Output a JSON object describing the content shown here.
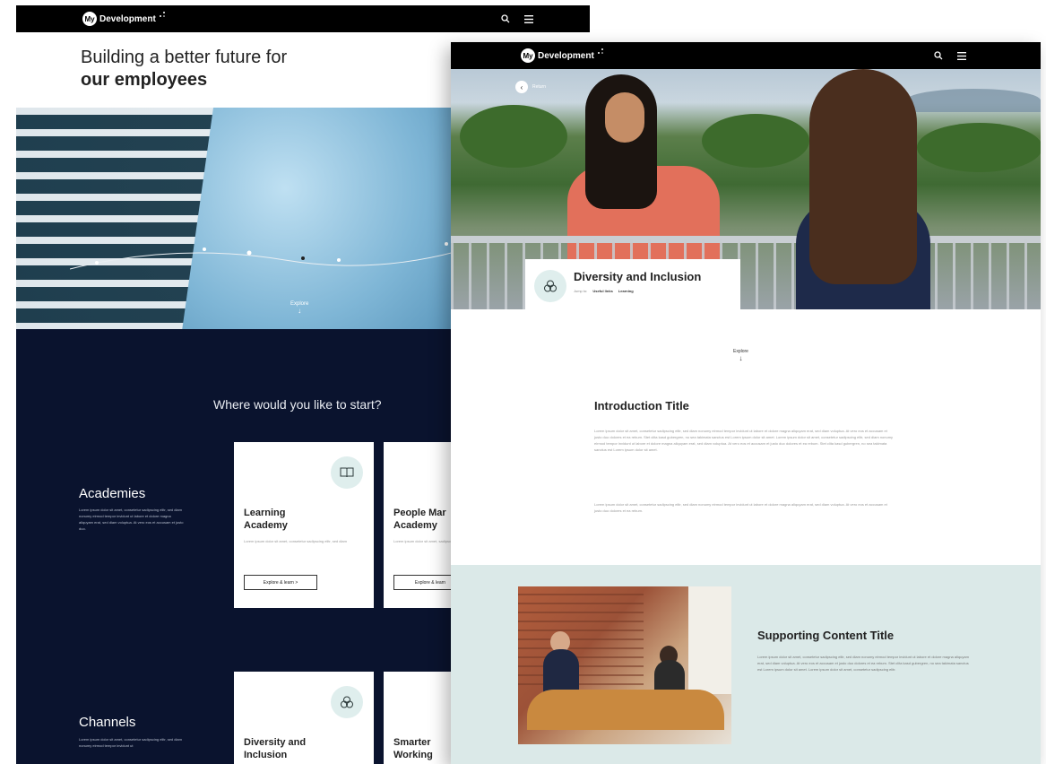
{
  "left_page": {
    "nav": {
      "logo_badge": "My",
      "logo_text": "Development",
      "icons": [
        "search-icon",
        "menu-icon"
      ]
    },
    "hero": {
      "title_line1": "Building a better future for",
      "title_line2": "our employees",
      "explore_label": "Explore"
    },
    "start_heading": "Where would you like to start?",
    "academies": {
      "title": "Academies",
      "text": "Lorem ipsum dolor sit amet, consetetur sadipscing elitr, sed diam nonumy eirmod tempor invidunt ut labore et dolore magna aliquyam erat, sed diam voluptua. At vero eos et accusam et justo duo."
    },
    "channels": {
      "title": "Channels",
      "text": "Lorem ipsum dolor sit amet, consetetur sadipscing elitr, sed diam nonumy eirmod tempor invidunt ut"
    },
    "cards": [
      {
        "title_line1": "Learning",
        "title_line2": "Academy",
        "text": "Lorem ipsum dolor sit amet, consetetur sadipscing elitr, sed diam",
        "button": "Explore & learn  >",
        "icon": "book-icon"
      },
      {
        "title_line1": "People Mar",
        "title_line2": "Academy",
        "text": "Lorem ipsum dolor sit amet, sadipscing elitr, sed diam",
        "button": "Explore & learn",
        "icon": ""
      },
      {
        "title_line1": "Diversity and",
        "title_line2": "Inclusion",
        "text": "",
        "button": "",
        "icon": "inclusion-icon"
      },
      {
        "title_line1": "Smarter",
        "title_line2": "Working",
        "text": "",
        "button": "",
        "icon": ""
      }
    ]
  },
  "right_page": {
    "nav": {
      "logo_badge": "My",
      "logo_text": "Development",
      "icons": [
        "search-icon",
        "menu-icon"
      ]
    },
    "return_label": "Return",
    "di_card": {
      "title": "Diversity and Inclusion",
      "jump_label": "Jump to:",
      "links": [
        "Useful links",
        "Learning"
      ],
      "icon": "inclusion-icon"
    },
    "explore_label": "Explore",
    "intro": {
      "title": "Introduction Title",
      "para1": "Lorem ipsum dolor sit amet, consetetur sadipscing elitr, sed diam nonumy eirmod tempor invidunt ut labore et dolore magna aliquyam erat, sed diam voluptua. At vero eos et accusam et justo duo dolores et ea rebum. Stet clita kasd gubergren, no sea takimata sanctus est Lorem ipsum dolor sit amet. Lorem ipsum dolor sit amet, consetetur sadipscing elitr, sed diam nonumy eirmod tempor invidunt ut labore et dolore magna aliquyam erat, sed diam voluptua. At vero eos et accusam et justo duo dolores et ea rebum. Stet clita kasd gubergren, no sea takimata sanctus est Lorem ipsum dolor sit amet.",
      "para2": "Lorem ipsum dolor sit amet, consetetur sadipscing elitr, sed diam nonumy eirmod tempor invidunt ut labore et dolore magna aliquyam erat, sed diam voluptua. At vero eos et accusam et justo duo dolores et ea rebum."
    },
    "support": {
      "title": "Supporting Content Title",
      "text": "Lorem ipsum dolor sit amet, consetetur sadipscing elitr, sed diam nonumy eirmod tempor invidunt ut labore et dolore magna aliquyam erat, sed diam voluptua. At vero eos et accusam et justo duo dolores et ea rebum. Stet clita kasd gubergren, no sea takimata sanctus est Lorem ipsum dolor sit amet. Lorem ipsum dolor sit amet, consetetur sadipscing elitr."
    }
  },
  "colors": {
    "nav_bg": "#000000",
    "dark_section": "#0a132e",
    "teal_section": "#dbe9e8",
    "icon_circle": "#dfeeed"
  }
}
